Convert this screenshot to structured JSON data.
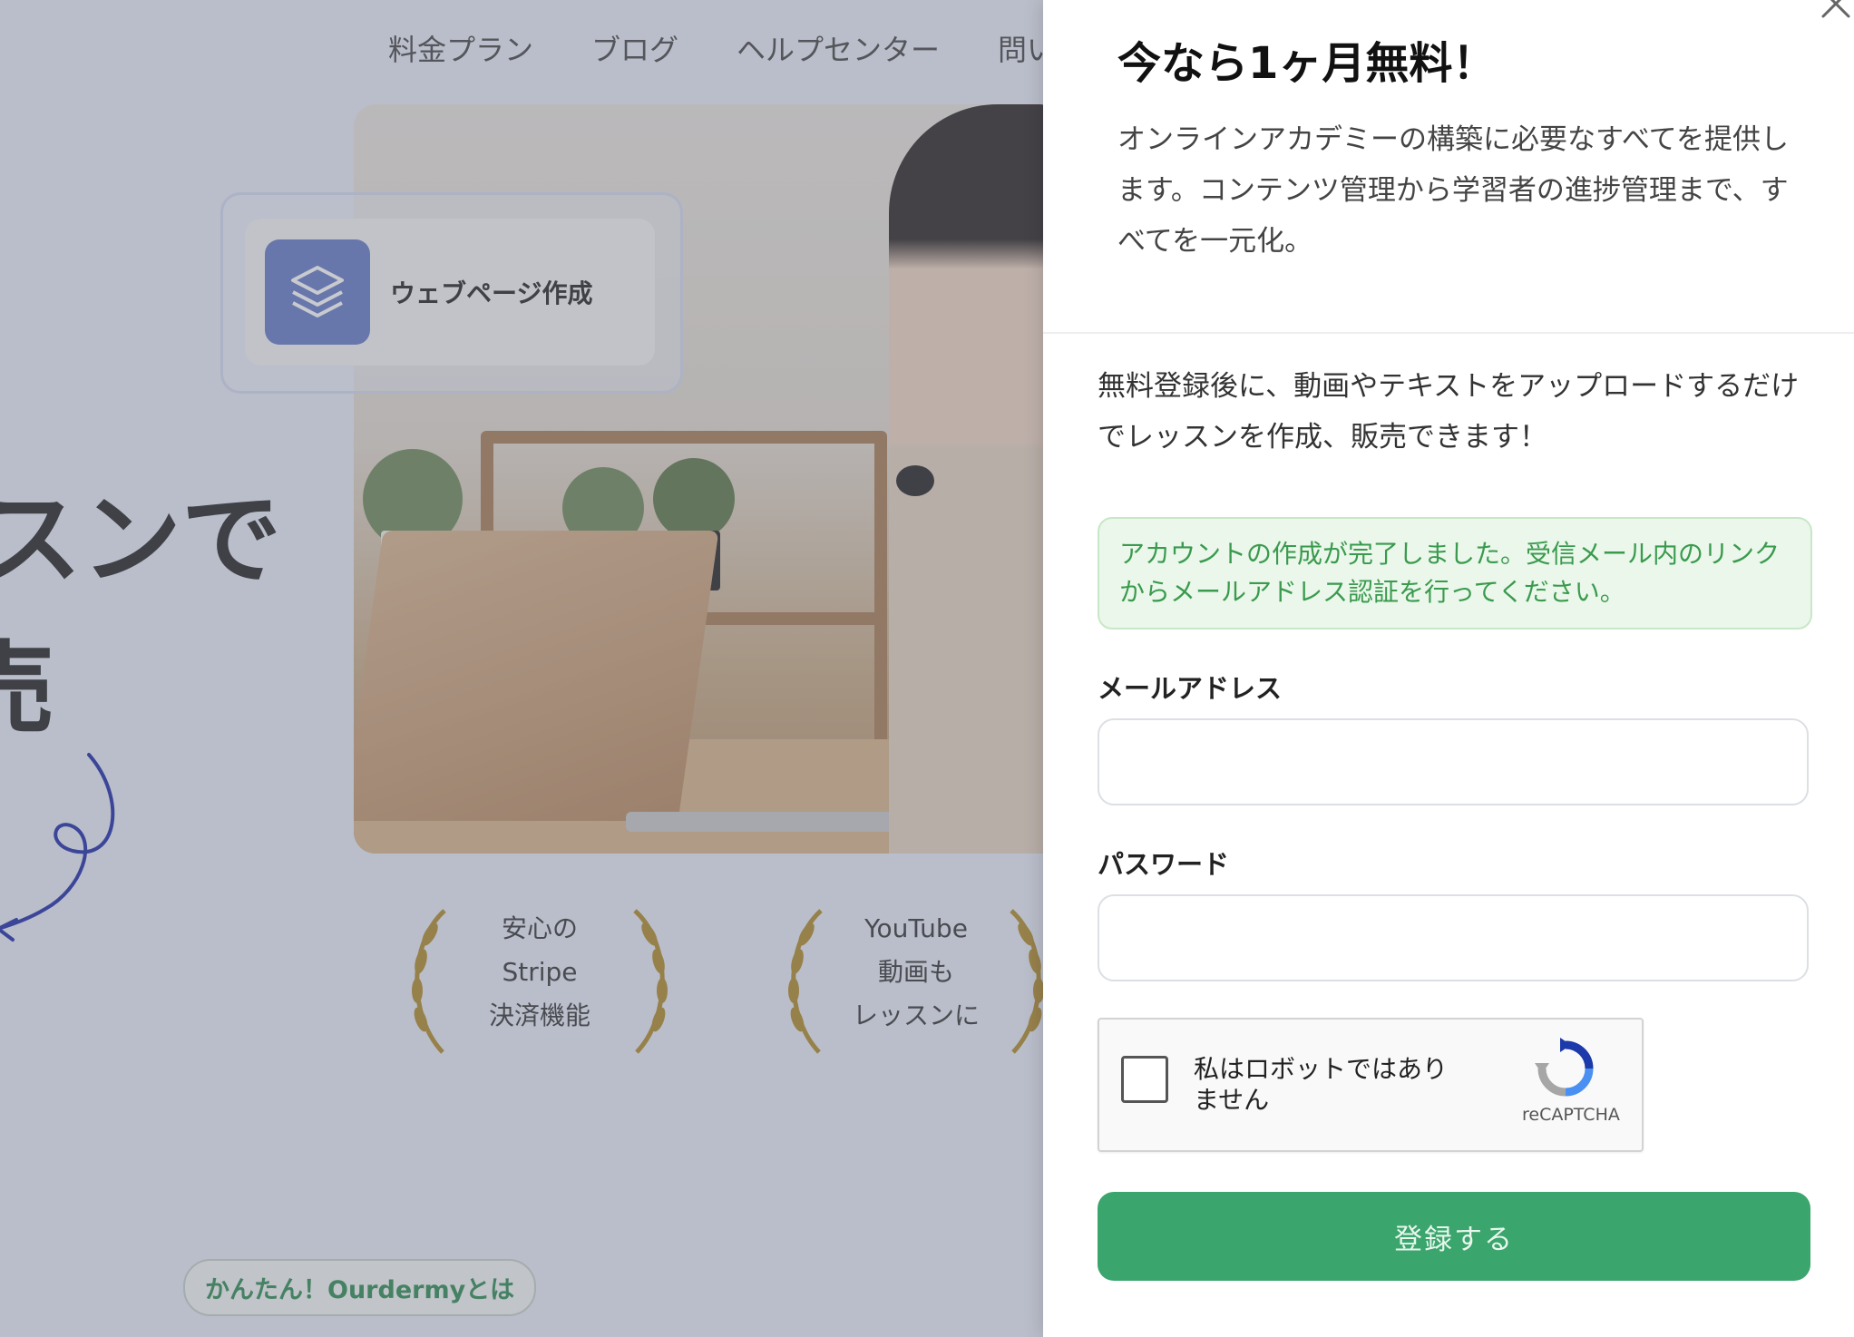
{
  "background": {
    "nav": [
      "料金プラン",
      "ブログ",
      "ヘルプセンター",
      "問い"
    ],
    "feature_label": "ウェブページ作成",
    "hero_heading_line1": "スンで",
    "hero_heading_line2": "売",
    "hero_small": "!",
    "awards": [
      {
        "lines": [
          "安心の",
          "Stripe",
          "決済機能"
        ]
      },
      {
        "lines": [
          "YouTube",
          "動画も",
          "レッスンに"
        ]
      }
    ],
    "tag": "かんたん！Ourdermyとは"
  },
  "drawer": {
    "title": "今なら1ヶ月無料！",
    "description": "オンラインアカデミーの構築に必要なすべてを提供します。コンテンツ管理から学習者の進捗管理まで、すべてを一元化。",
    "intro": "無料登録後に、動画やテキストをアップロードするだけでレッスンを作成、販売できます！",
    "alert": "アカウントの作成が完了しました。受信メール内のリンクからメールアドレス認証を行ってください。",
    "email_label": "メールアドレス",
    "email_value": "",
    "password_label": "パスワード",
    "password_value": "",
    "captcha_text": "私はロボットではありません",
    "captcha_brand": "reCAPTCHA",
    "submit_label": "登録する"
  },
  "colors": {
    "accent_green": "#3aa56c",
    "alert_bg": "#eaf7ea",
    "alert_text": "#3a9a4e",
    "feature_icon_bg": "#6479c5",
    "laurel_gold": "#b08a2a"
  }
}
